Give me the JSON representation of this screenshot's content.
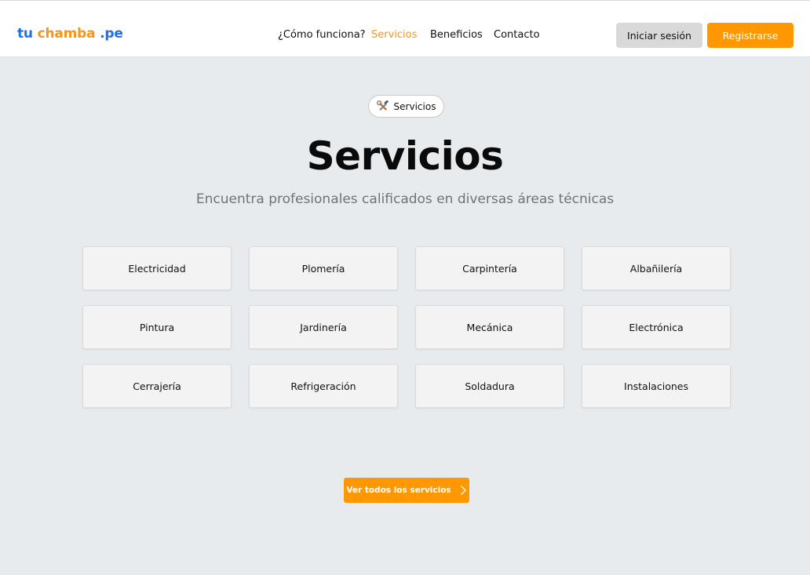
{
  "brand": {
    "part1": "tu",
    "part2": "chamba",
    "part3": ".pe"
  },
  "nav": [
    {
      "label": "¿Cómo funciona?",
      "active": false
    },
    {
      "label": "Servicios",
      "active": true
    },
    {
      "label": "Beneficios",
      "active": false
    },
    {
      "label": "Contacto",
      "active": false
    }
  ],
  "auth": {
    "login_label": "Iniciar sesión",
    "register_label": "Registrarse"
  },
  "hero": {
    "badge_icon": "tools-icon",
    "badge_label": "Servicios",
    "title": "Servicios",
    "subtitle": "Encuentra profesionales calificados en diversas áreas técnicas"
  },
  "services": [
    "Electricidad",
    "Plomería",
    "Carpintería",
    "Albañilería",
    "Pintura",
    "Jardinería",
    "Mecánica",
    "Electrónica",
    "Cerrajería",
    "Refrigeración",
    "Soldadura",
    "Instalaciones"
  ],
  "cta": {
    "label": "Ver todos los servicios",
    "icon": "chevron-right-icon"
  },
  "colors": {
    "brand_blue": "#1f6fe5",
    "accent_orange": "#ff9800",
    "background": "#e8ebee",
    "card_background": "#f3f3f3"
  }
}
